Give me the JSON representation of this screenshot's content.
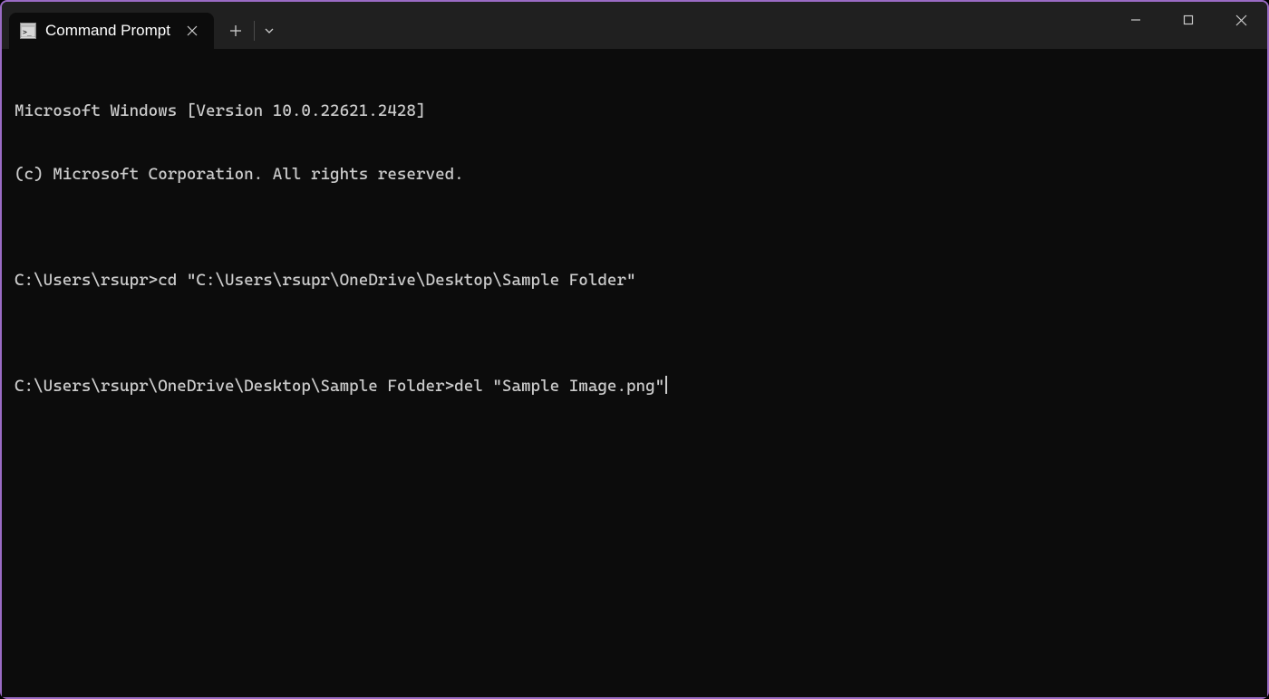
{
  "titlebar": {
    "tab": {
      "title": "Command Prompt"
    }
  },
  "terminal": {
    "lines": [
      "Microsoft Windows [Version 10.0.22621.2428]",
      "(c) Microsoft Corporation. All rights reserved.",
      "",
      "C:\\Users\\rsupr>cd \"C:\\Users\\rsupr\\OneDrive\\Desktop\\Sample Folder\"",
      "",
      "C:\\Users\\rsupr\\OneDrive\\Desktop\\Sample Folder>del \"Sample Image.png\""
    ]
  }
}
